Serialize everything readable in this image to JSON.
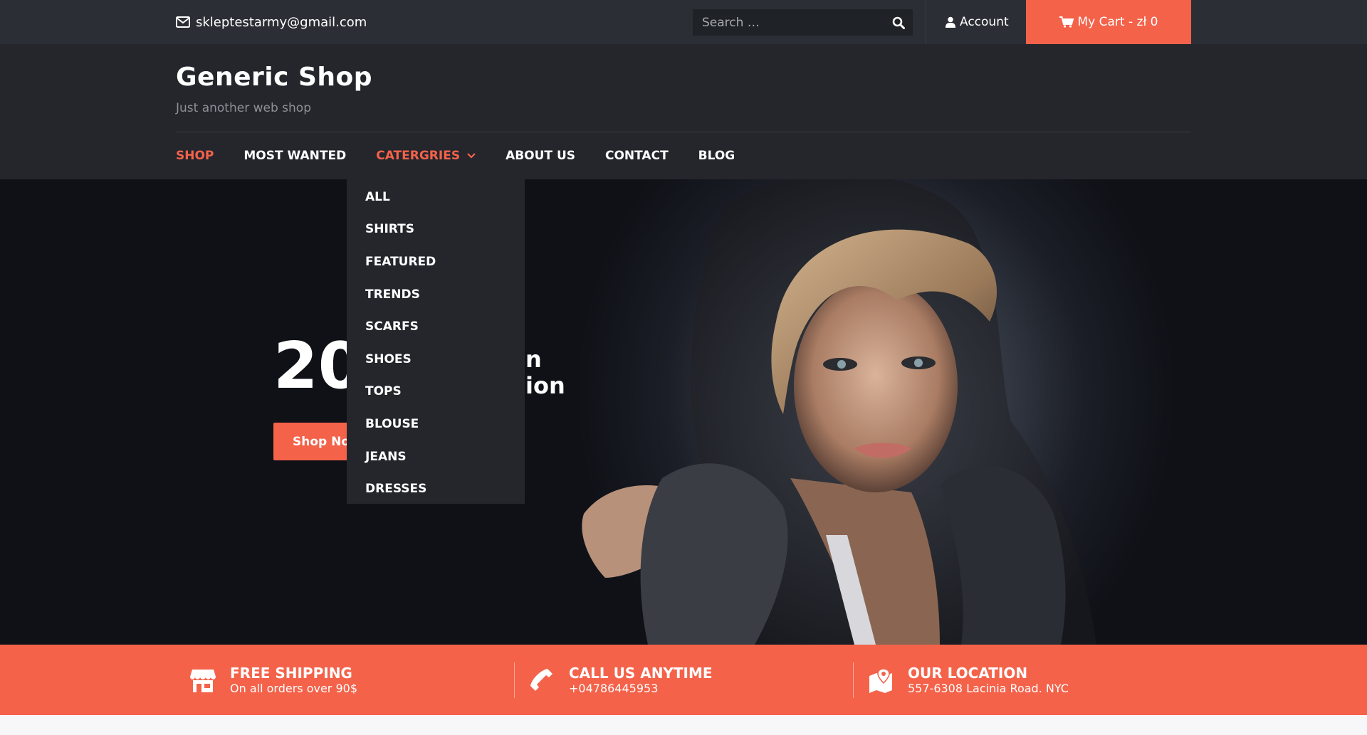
{
  "topbar": {
    "email": "skleptestarmy@gmail.com",
    "search_placeholder": "Search …",
    "account_label": "Account",
    "cart_label": "My Cart - zł 0"
  },
  "header": {
    "title": "Generic Shop",
    "tagline": "Just another web shop"
  },
  "nav": {
    "items": [
      {
        "label": "SHOP",
        "active": true
      },
      {
        "label": "MOST WANTED",
        "active": false
      },
      {
        "label": "CATERGRIES",
        "active": true,
        "has_dropdown": true
      },
      {
        "label": "ABOUT US",
        "active": false
      },
      {
        "label": "CONTACT",
        "active": false
      },
      {
        "label": "BLOG",
        "active": false
      }
    ]
  },
  "dropdown": {
    "items": [
      "ALL",
      "SHIRTS",
      "FEATURED",
      "TRENDS",
      "SCARFS",
      "SHOES",
      "TOPS",
      "BLOUSE",
      "JEANS",
      "DRESSES"
    ]
  },
  "hero": {
    "heading_visible": "20",
    "subheading_line1": "n",
    "subheading_line2": "ion",
    "button_label": "Shop No"
  },
  "features": [
    {
      "icon": "store-icon",
      "title": "FREE SHIPPING",
      "subtitle": "On all orders over 90$"
    },
    {
      "icon": "phone-icon",
      "title": "CALL US ANYTIME",
      "subtitle": "+04786445953"
    },
    {
      "icon": "map-pin-icon",
      "title": "OUR LOCATION",
      "subtitle": "557-6308 Lacinia Road. NYC"
    }
  ],
  "colors": {
    "accent": "#f4624a",
    "topbar_bg": "#2b2e34",
    "header_bg": "#24262c"
  }
}
